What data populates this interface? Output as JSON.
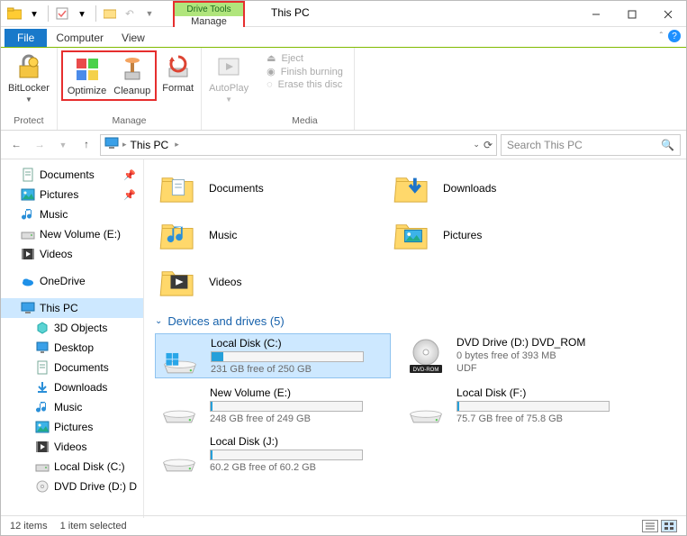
{
  "titlebar": {
    "title": "This PC",
    "context_tab_top": "Drive Tools",
    "context_tab_bottom": "Manage"
  },
  "menubar": {
    "file": "File",
    "tabs": [
      "Computer",
      "View"
    ]
  },
  "ribbon": {
    "protect": {
      "label": "Protect",
      "bitlocker": "BitLocker"
    },
    "manage": {
      "label": "Manage",
      "optimize": "Optimize",
      "cleanup": "Cleanup",
      "format": "Format"
    },
    "autoplay": "AutoPlay",
    "media": {
      "label": "Media",
      "eject": "Eject",
      "finish": "Finish burning",
      "erase": "Erase this disc"
    }
  },
  "nav": {
    "breadcrumb": [
      "This PC"
    ],
    "search_placeholder": "Search This PC"
  },
  "sidebar": {
    "quick": [
      {
        "label": "Documents",
        "icon": "documents",
        "pinned": true
      },
      {
        "label": "Pictures",
        "icon": "pictures",
        "pinned": true
      },
      {
        "label": "Music",
        "icon": "music",
        "pinned": false
      },
      {
        "label": "New Volume (E:)",
        "icon": "drive",
        "pinned": false
      },
      {
        "label": "Videos",
        "icon": "videos",
        "pinned": false
      }
    ],
    "onedrive": "OneDrive",
    "thispc": "This PC",
    "thispc_children": [
      {
        "label": "3D Objects",
        "icon": "3d"
      },
      {
        "label": "Desktop",
        "icon": "desktop"
      },
      {
        "label": "Documents",
        "icon": "documents"
      },
      {
        "label": "Downloads",
        "icon": "downloads"
      },
      {
        "label": "Music",
        "icon": "music"
      },
      {
        "label": "Pictures",
        "icon": "pictures"
      },
      {
        "label": "Videos",
        "icon": "videos"
      },
      {
        "label": "Local Disk (C:)",
        "icon": "drive"
      },
      {
        "label": "DVD Drive (D:) D",
        "icon": "dvd"
      }
    ]
  },
  "folders": [
    {
      "label": "Documents",
      "icon": "documents"
    },
    {
      "label": "Downloads",
      "icon": "downloads"
    },
    {
      "label": "Music",
      "icon": "music"
    },
    {
      "label": "Pictures",
      "icon": "pictures"
    },
    {
      "label": "Videos",
      "icon": "videos"
    }
  ],
  "section_header": "Devices and drives (5)",
  "drives": [
    {
      "name": "Local Disk (C:)",
      "free": "231 GB free of 250 GB",
      "fill": 8,
      "icon": "win",
      "selected": true
    },
    {
      "name": "DVD Drive (D:) DVD_ROM",
      "free": "0 bytes free of 393 MB",
      "sub": "UDF",
      "icon": "dvd"
    },
    {
      "name": "New Volume (E:)",
      "free": "248 GB free of 249 GB",
      "fill": 1,
      "icon": "hdd"
    },
    {
      "name": "Local Disk (F:)",
      "free": "75.7 GB free of 75.8 GB",
      "fill": 1,
      "icon": "hdd"
    },
    {
      "name": "Local Disk (J:)",
      "free": "60.2 GB free of 60.2 GB",
      "fill": 1,
      "icon": "hdd"
    }
  ],
  "status": {
    "items": "12 items",
    "selected": "1 item selected"
  },
  "colors": {
    "accent": "#1979ca",
    "highlight": "#cde8ff",
    "red": "#e62e2e",
    "green": "#b0e57c"
  }
}
